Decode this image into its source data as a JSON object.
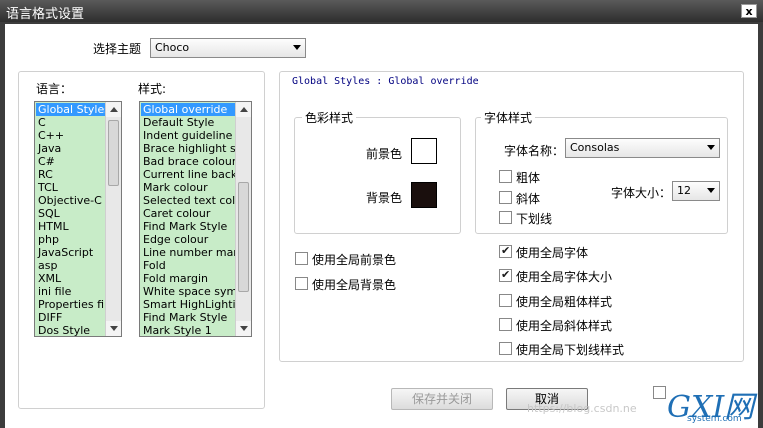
{
  "window": {
    "title": "语言格式设置",
    "close_label": "x"
  },
  "theme": {
    "label": "选择主题",
    "selected": "Choco"
  },
  "languages": {
    "header": "语言：",
    "items": [
      "Global Styles",
      "C",
      "C++",
      "Java",
      "C#",
      "RC",
      "TCL",
      "Objective-C",
      "SQL",
      "HTML",
      "php",
      "JavaScript",
      "asp",
      "XML",
      "ini file",
      "Properties file",
      "DIFF",
      "Dos Style"
    ],
    "selected_index": 0
  },
  "styles": {
    "header": "样式:",
    "items": [
      "Global override",
      "Default Style",
      "Indent guideline style",
      "Brace highlight style",
      "Bad brace colour",
      "Current line background",
      "Mark colour",
      "Selected text colour",
      "Caret colour",
      "Find Mark Style",
      "Edge colour",
      "Line number margin",
      "Fold",
      "Fold margin",
      "White space symbol",
      "Smart HighLighting",
      "Find Mark Style",
      "Mark Style 1"
    ],
    "selected_index": 0
  },
  "breadcrumb": "Global Styles : Global override",
  "colour_style": {
    "group_label": "色彩样式",
    "foreground_label": "前景色",
    "background_label": "背景色",
    "foreground_color": "#ffffff",
    "background_color": "#1a0f0d"
  },
  "font_style": {
    "group_label": "字体样式",
    "font_name_label": "字体名称：",
    "font_name_value": "Consolas",
    "bold_label": "粗体",
    "italic_label": "斜体",
    "underline_label": "下划线",
    "font_size_label": "字体大小：",
    "font_size_value": "12"
  },
  "global_options": {
    "use_global_fg": "使用全局前景色",
    "use_global_bg": "使用全局背景色",
    "use_global_font": "使用全局字体",
    "use_global_font_size": "使用全局字体大小",
    "use_global_bold": "使用全局粗体样式",
    "use_global_italic": "使用全局斜体样式",
    "use_global_underline": "使用全局下划线样式"
  },
  "buttons": {
    "save_close": "保存并关闭",
    "cancel": "取消"
  },
  "watermark": {
    "text": "https://blog.csdn.ne",
    "logo": "GXI网",
    "logo_sub": "system.com"
  }
}
